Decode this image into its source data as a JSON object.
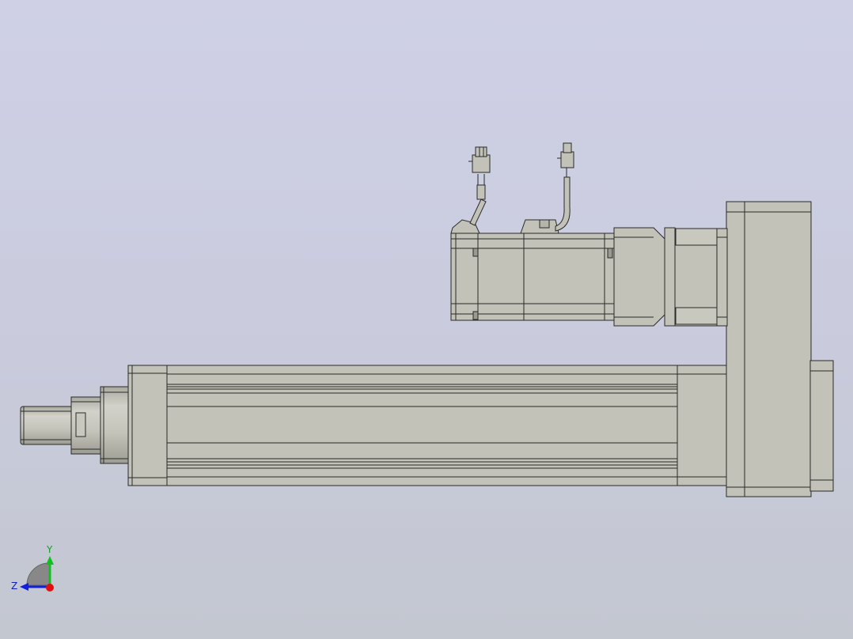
{
  "viewport": {
    "background_top": "#cfd0e6",
    "background_bottom": "#c3c7d0",
    "part_color": "#c2c2b8",
    "edge_color": "#2a2a2a"
  },
  "triad": {
    "y_label": "Y",
    "z_label": "Z",
    "x_axis_color": "#e01010",
    "y_axis_color": "#10c020",
    "z_axis_color": "#1020e0"
  }
}
